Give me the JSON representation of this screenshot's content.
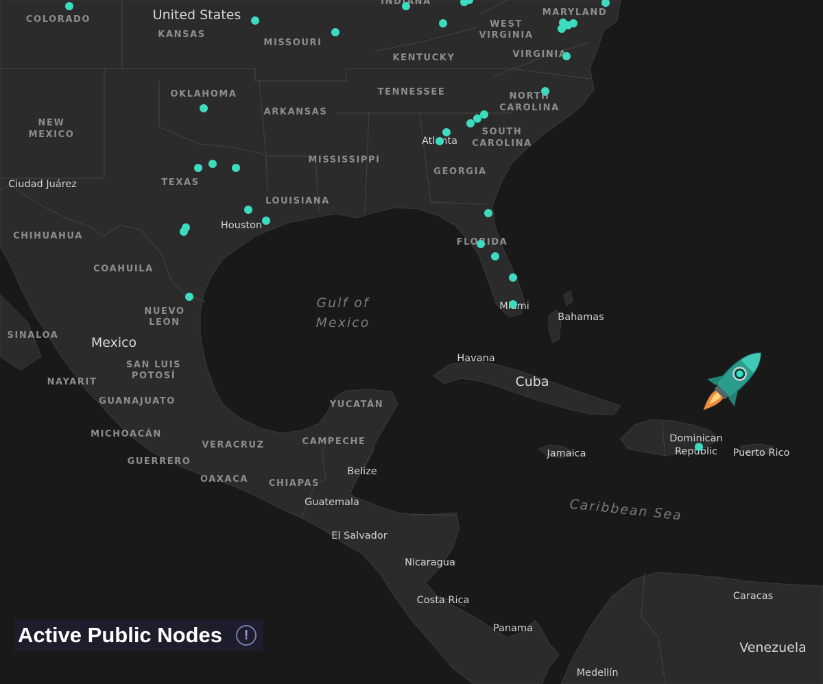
{
  "map": {
    "states": [
      "COLORADO",
      "KANSAS",
      "MISSOURI",
      "INDIANA",
      "WEST VIRGINIA",
      "MARYLAND",
      "KENTUCKY",
      "VIRGINIA",
      "OKLAHOMA",
      "NEW MEXICO",
      "ARKANSAS",
      "TENNESSEE",
      "NORTH CAROLINA",
      "SOUTH CAROLINA",
      "MISSISSIPPI",
      "GEORGIA",
      "TEXAS",
      "LOUISIANA",
      "FLORIDA",
      "CHIHUAHUA",
      "COAHUILA",
      "NUEVO LEÓN",
      "SINALOA",
      "SAN LUIS POTOSÍ",
      "NAYARIT",
      "GUANAJUATO",
      "MICHOACÁN",
      "GUERRERO",
      "VERACRUZ",
      "YUCATÁN",
      "CAMPECHE",
      "OAXACA",
      "CHIAPAS"
    ],
    "countries": [
      "United States",
      "Mexico",
      "Cuba",
      "Belize",
      "Guatemala",
      "El Salvador",
      "Nicaragua",
      "Costa Rica",
      "Panama",
      "Venezuela",
      "Dominican Republic",
      "Jamaica",
      "Puerto Rico",
      "Bahamas"
    ],
    "cities": [
      "Ciudad Juárez",
      "Houston",
      "Atlanta",
      "Miami",
      "Havana",
      "Caracas",
      "Medellín"
    ],
    "water": [
      "Gulf of Mexico",
      "Caribbean Sea"
    ]
  },
  "legend": {
    "title": "Active Public Nodes",
    "info_glyph": "!"
  },
  "node_color": "#3ddbc0",
  "rocket_icon": "rocket-icon"
}
